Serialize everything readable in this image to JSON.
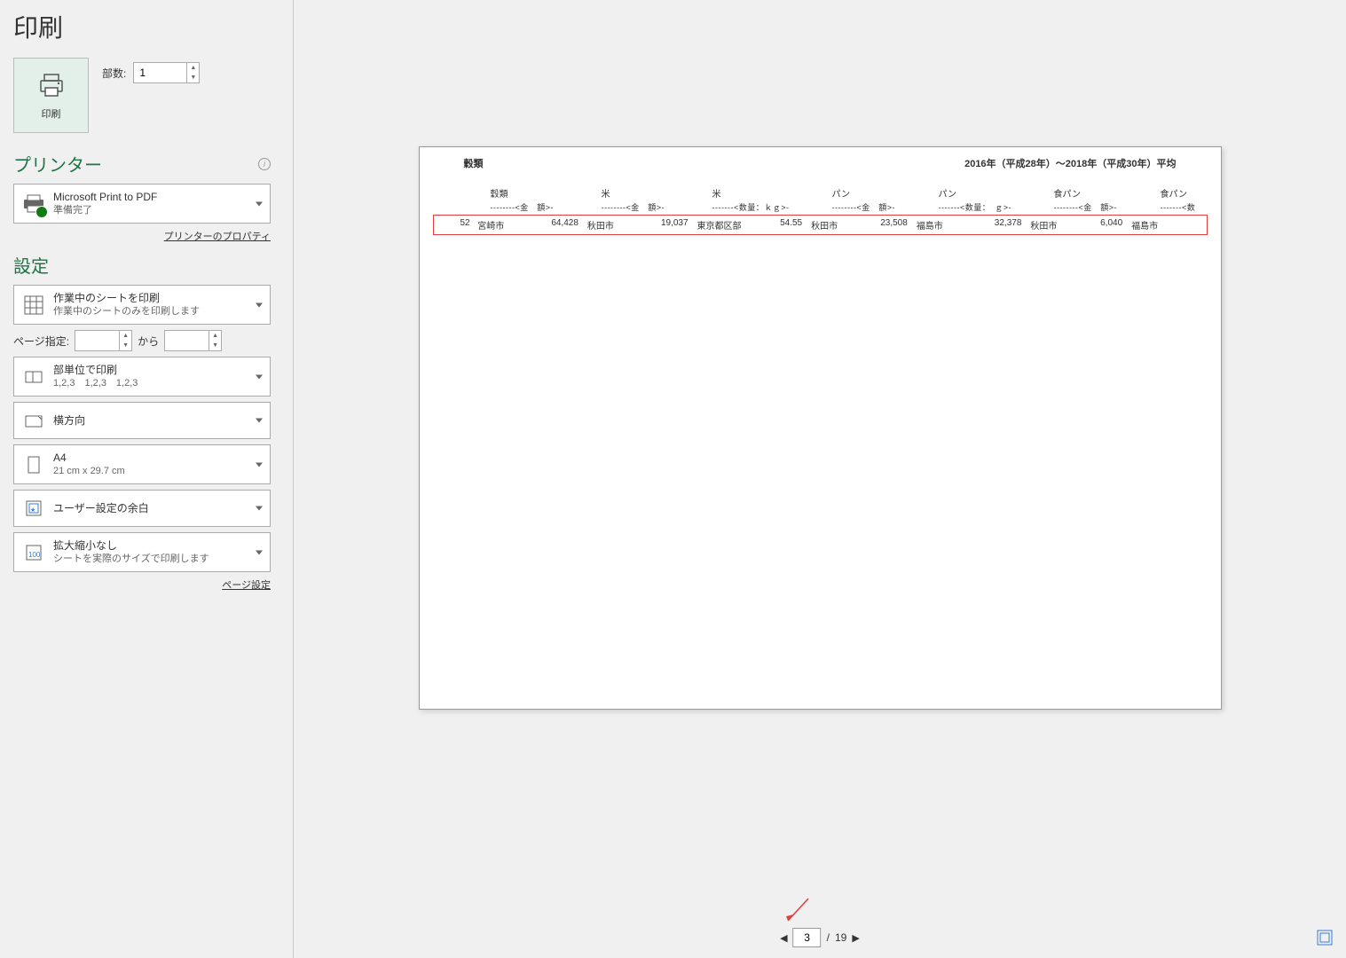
{
  "title": "印刷",
  "copies": {
    "label": "部数:",
    "value": "1"
  },
  "print_button": {
    "label": "印刷"
  },
  "printer": {
    "section": "プリンター",
    "name": "Microsoft Print to PDF",
    "status": "準備完了",
    "properties_link": "プリンターのプロパティ"
  },
  "settings": {
    "section": "設定",
    "what_to_print": {
      "title": "作業中のシートを印刷",
      "sub": "作業中のシートのみを印刷します"
    },
    "page_range": {
      "label": "ページ指定:",
      "from": "",
      "to_label": "から",
      "to": ""
    },
    "collate": {
      "title": "部単位で印刷",
      "sub": "1,2,3　1,2,3　1,2,3"
    },
    "orientation": {
      "title": "横方向"
    },
    "paper": {
      "title": "A4",
      "sub": "21 cm x 29.7 cm"
    },
    "margins": {
      "title": "ユーザー設定の余白"
    },
    "scaling": {
      "title": "拡大縮小なし",
      "sub": "シートを実際のサイズで印刷します"
    },
    "page_setup_link": "ページ設定"
  },
  "preview": {
    "header_left": "穀類",
    "header_right": "2016年（平成28年）～2018年（平成30年）平均",
    "col_groups": [
      "穀類",
      "米",
      "米",
      "パン",
      "パン",
      "食パン",
      "食パン"
    ],
    "col_subs": [
      "--------<金　額>-",
      "--------<金　額>-",
      "-------<数量：ｋｇ>-",
      "--------<金　額>-",
      "-------<数量：　ｇ>-",
      "--------<金　額>-",
      "-------<数"
    ],
    "row": {
      "idx": "52",
      "city1": "宮崎市",
      "v1": "64,428",
      "city2": "秋田市",
      "v2": "19,037",
      "city3": "東京都区部",
      "v3": "54.55",
      "city4": "秋田市",
      "v4": "23,508",
      "city5": "福島市",
      "v5": "32,378",
      "city6": "秋田市",
      "v6": "6,040",
      "city7": "福島市"
    }
  },
  "pager": {
    "current": "3",
    "total": "19",
    "sep": "/"
  },
  "colors": {
    "accent": "#217346",
    "highlight": "#e83d3d"
  }
}
